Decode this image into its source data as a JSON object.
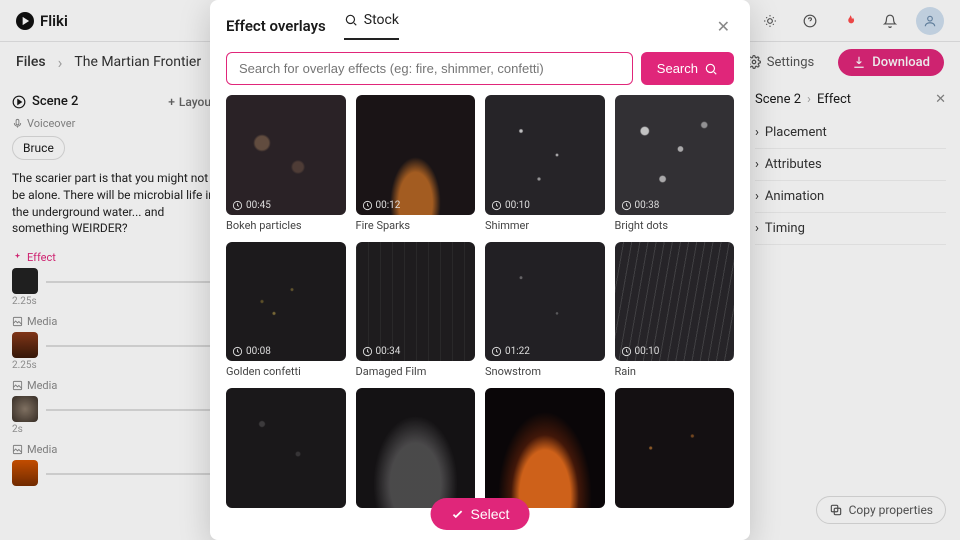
{
  "brand": "Fliki",
  "crumbs": {
    "files": "Files",
    "project": "The Martian Frontier"
  },
  "topbar": {
    "settings": "Settings",
    "download": "Download"
  },
  "scene": {
    "label": "Scene 2",
    "layout": "Layout"
  },
  "voiceover": {
    "label": "Voiceover",
    "name": "Bruce"
  },
  "script": "The scarier part is that you might not be alone. There will be microbial life in the underground water... and something WEIRDER?",
  "layers": {
    "effect": {
      "label": "Effect",
      "dur": "2.25s"
    },
    "media1": {
      "label": "Media",
      "dur": "2.25s"
    },
    "media2": {
      "label": "Media",
      "dur": "2s"
    },
    "media3": {
      "label": "Media"
    }
  },
  "right": {
    "scene": "Scene 2",
    "effect": "Effect",
    "placement": "Placement",
    "attributes": "Attributes",
    "animation": "Animation",
    "timing": "Timing",
    "copy": "Copy properties"
  },
  "modal": {
    "title": "Effect overlays",
    "tab_stock": "Stock",
    "search_placeholder": "Search for overlay effects (eg: fire, shimmer, confetti)",
    "search_btn": "Search",
    "select": "Select",
    "items": [
      {
        "label": "Bokeh particles",
        "time": "00:45",
        "cls": "ov-bokeh"
      },
      {
        "label": "Fire Sparks",
        "time": "00:12",
        "cls": "ov-fire"
      },
      {
        "label": "Shimmer",
        "time": "00:10",
        "cls": "ov-shimmer"
      },
      {
        "label": "Bright dots",
        "time": "00:38",
        "cls": "ov-dots"
      },
      {
        "label": "Golden confetti",
        "time": "00:08",
        "cls": "ov-confetti"
      },
      {
        "label": "Damaged Film",
        "time": "00:34",
        "cls": "ov-film"
      },
      {
        "label": "Snowstrom",
        "time": "01:22",
        "cls": "ov-snow"
      },
      {
        "label": "Rain",
        "time": "00:10",
        "cls": "ov-rain"
      },
      {
        "label": "",
        "time": "",
        "cls": "ov-drops"
      },
      {
        "label": "",
        "time": "",
        "cls": "ov-smoke"
      },
      {
        "label": "",
        "time": "",
        "cls": "ov-flames"
      },
      {
        "label": "",
        "time": "",
        "cls": "ov-sparks2"
      }
    ]
  }
}
